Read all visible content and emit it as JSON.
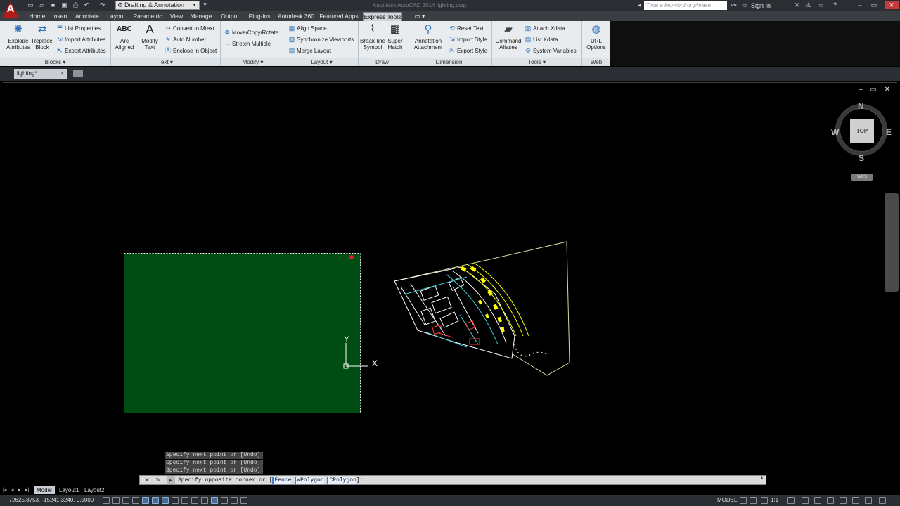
{
  "app": {
    "title": "Autodesk AutoCAD 2014    lighting.dwg",
    "logo_letter": "A"
  },
  "quick_access": {
    "workspace": "Drafting & Annotation",
    "icons": [
      "new-icon",
      "open-icon",
      "save-icon",
      "saveas-icon",
      "plot-icon",
      "undo-icon",
      "redo-icon"
    ]
  },
  "search": {
    "placeholder": "Type a keyword or phrase"
  },
  "account": {
    "signin_label": "Sign In"
  },
  "ribbon_tabs": [
    "Home",
    "Insert",
    "Annotate",
    "Layout",
    "Parametric",
    "View",
    "Manage",
    "Output",
    "Plug-ins",
    "Autodesk 360",
    "Featured Apps",
    "Express Tools"
  ],
  "active_tab": "Express Tools",
  "ribbon": {
    "blocks": {
      "label": "Blocks",
      "explode": "Explode\nAttributes",
      "explode_l1": "Explode",
      "explode_l2": "Attributes",
      "replace_l1": "Replace",
      "replace_l2": "Block",
      "list_properties": "List Properties",
      "import_attributes": "Import Attributes",
      "export_attributes": "Export Attributes"
    },
    "text": {
      "label": "Text",
      "arc_l1": "Arc",
      "arc_l2": "Aligned",
      "modify_l1": "Modify",
      "modify_l2": "Text",
      "convert_to_mtext": "Convert to Mtext",
      "auto_number": "Auto Number",
      "enclose_in_object": "Enclose in Object"
    },
    "modify": {
      "label": "Modify",
      "move_copy_rotate": "Move/Copy/Rotate",
      "stretch_multiple": "Stretch Multiple"
    },
    "layout": {
      "label": "Layout",
      "align_space": "Align Space",
      "sync_viewports": "Synchronize Viewports",
      "merge_layout": "Merge Layout"
    },
    "draw": {
      "label": "Draw",
      "breakline_l1": "Break-line",
      "breakline_l2": "Symbol",
      "super_l1": "Super",
      "super_l2": "Hatch"
    },
    "dimension": {
      "label": "Dimension",
      "annotation_l1": "Annotation",
      "annotation_l2": "Attachment",
      "reset_text": "Reset Text",
      "import_style": "Import Style",
      "export_style": "Export Style"
    },
    "tools": {
      "label": "Tools",
      "command_l1": "Command",
      "command_l2": "Aliases",
      "attach_xdata": "Attach Xdata",
      "list_xdata": "List Xdata",
      "system_variables": "System Variables"
    },
    "web": {
      "label": "Web",
      "url_l1": "URL",
      "url_l2": "Options"
    }
  },
  "file_tab": {
    "name": "lighting*"
  },
  "viewcube": {
    "face": "TOP",
    "north": "N",
    "south": "S",
    "east": "E",
    "west": "W",
    "wcs": "WCS"
  },
  "ucs": {
    "y_label": "Y",
    "x_label": "X"
  },
  "command_history": [
    "Specify next point or [Undo]:",
    "Specify next point or [Undo]:",
    "Specify next point or [Undo]:"
  ],
  "command_prompt": {
    "prefix": "Specify opposite corner or [",
    "fence": "Fence",
    "wpolygon": "WPolygon",
    "cpolygon": "CPolygon",
    "suffix": "]:"
  },
  "layout_tabs": [
    "Model",
    "Layout1",
    "Layout2"
  ],
  "active_layout": "Model",
  "status": {
    "coordinates": "-72625.8753, -15241.3240, 0.0000",
    "model": "MODEL",
    "scale": "1:1"
  },
  "colors": {
    "selection_fill": "#004d13",
    "drawing_lines": "#ffffff",
    "yellow_layer": "#ffff00",
    "cyan_layer": "#3fc9d8",
    "red_layer": "#ff3b3b"
  }
}
